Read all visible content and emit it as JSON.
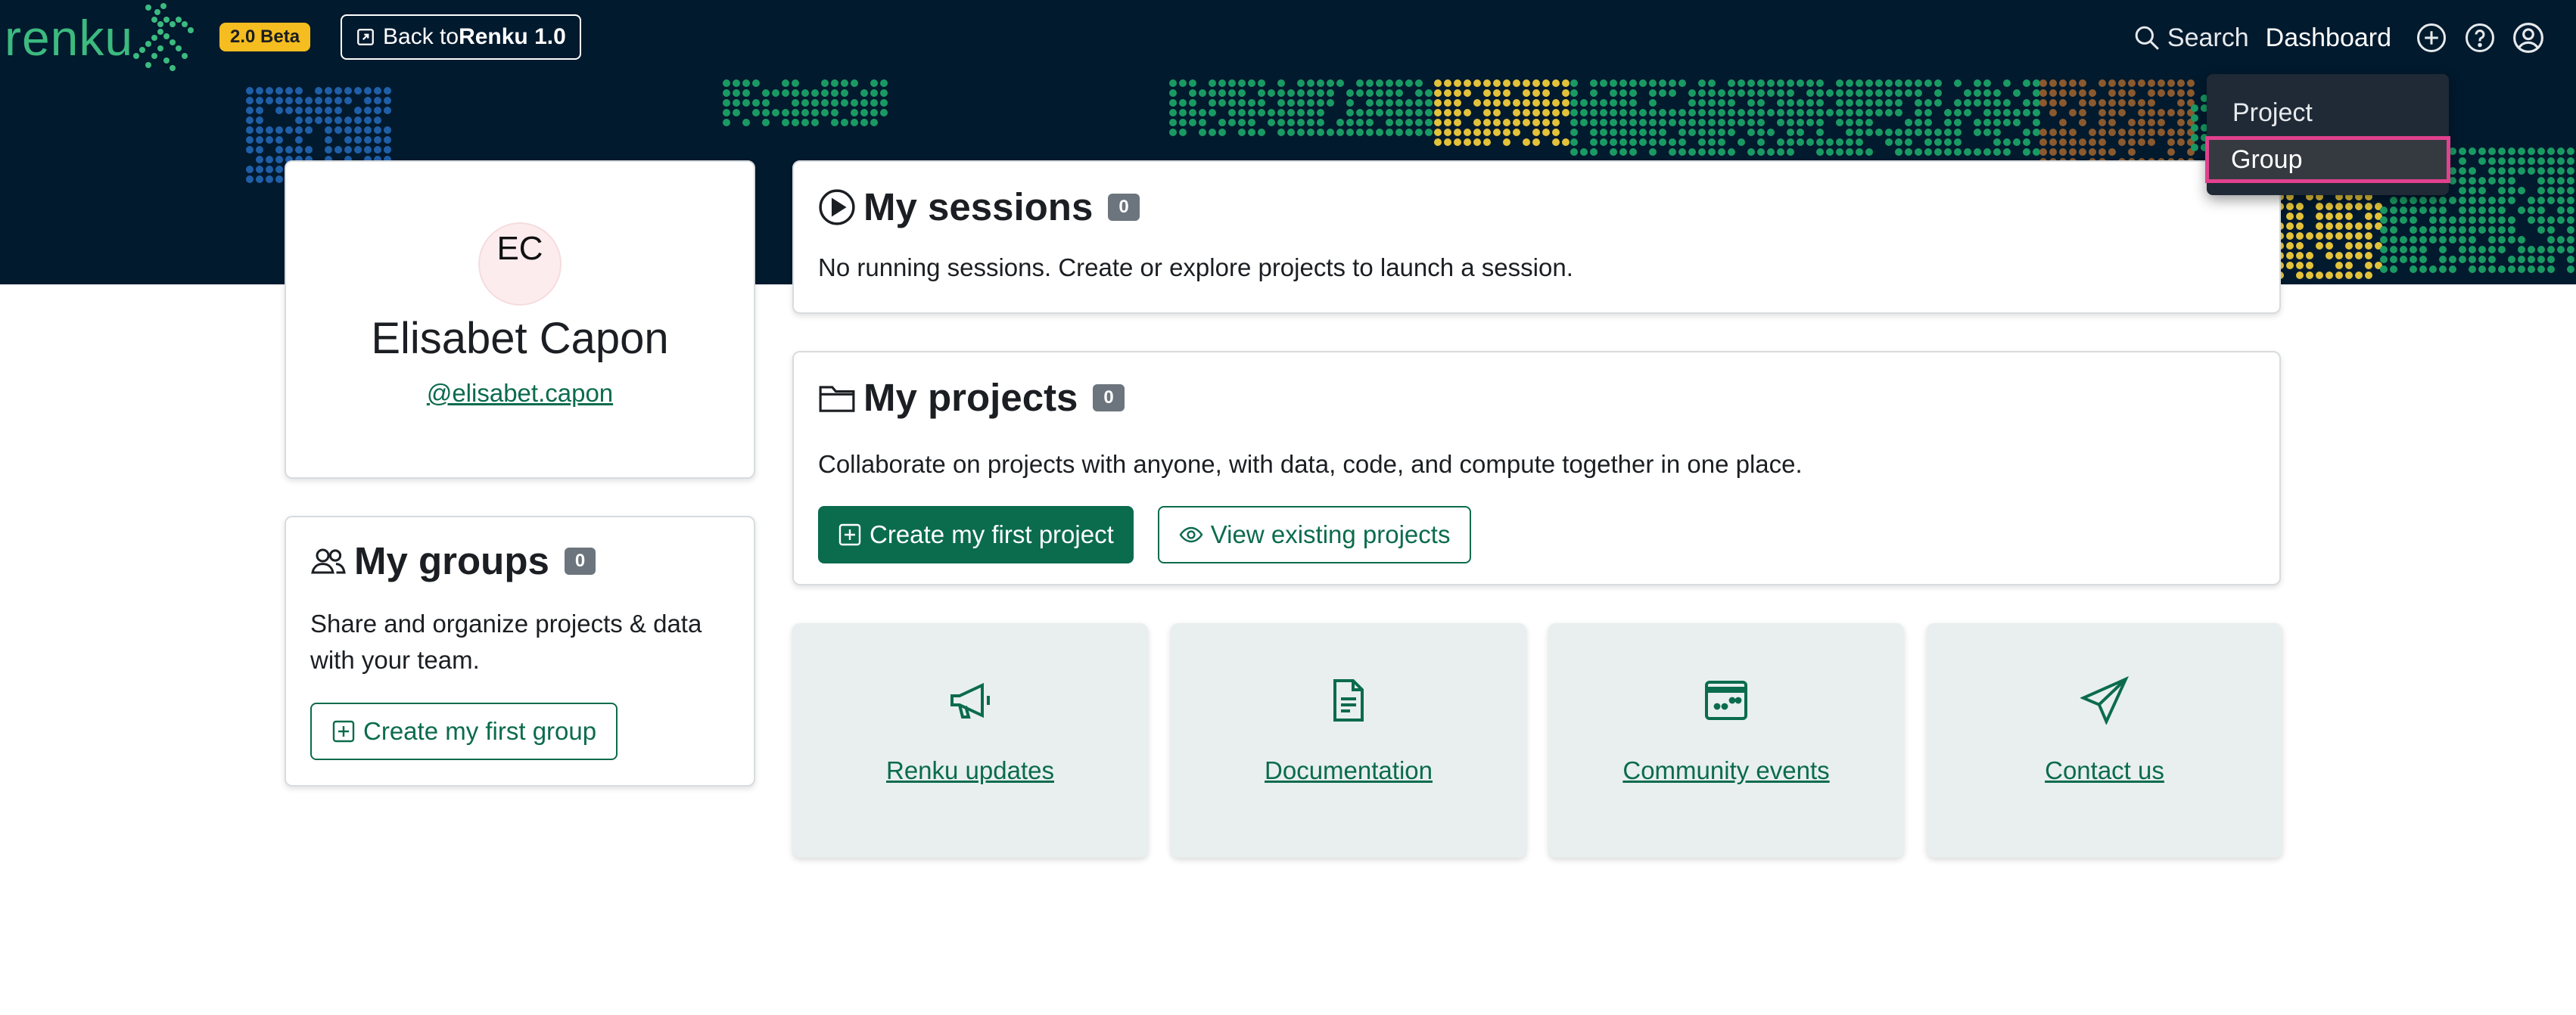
{
  "navbar": {
    "logo_text": "renku",
    "beta_badge": "2.0 Beta",
    "back_prefix": "Back to ",
    "back_bold": "Renku 1.0",
    "search_label": "Search",
    "dashboard_label": "Dashboard"
  },
  "dropdown": {
    "items": [
      {
        "label": "Project"
      },
      {
        "label": "Group"
      }
    ]
  },
  "profile": {
    "initials": "EC",
    "name": "Elisabet Capon",
    "handle": "@elisabet.capon"
  },
  "groups": {
    "title": "My groups",
    "count": "0",
    "description": "Share and organize projects & data with your team.",
    "create_button": "Create my first group"
  },
  "sessions": {
    "title": "My sessions",
    "count": "0",
    "description": "No running sessions. Create or explore projects to launch a session."
  },
  "projects": {
    "title": "My projects",
    "count": "0",
    "description": "Collaborate on projects with anyone, with data, code, and compute together in one place.",
    "create_button": "Create my first project",
    "view_button": "View existing projects"
  },
  "tiles": [
    {
      "label": "Renku updates",
      "icon": "megaphone-icon"
    },
    {
      "label": "Documentation",
      "icon": "document-icon"
    },
    {
      "label": "Community events",
      "icon": "calendar-icon"
    },
    {
      "label": "Contact us",
      "icon": "send-icon"
    }
  ],
  "colors": {
    "navbar_bg": "#021a2e",
    "brand_green": "#0b6b4d",
    "logo_green": "#3cba7f",
    "beta_yellow": "#f5bd1f",
    "highlight_pink": "#e2418e"
  }
}
